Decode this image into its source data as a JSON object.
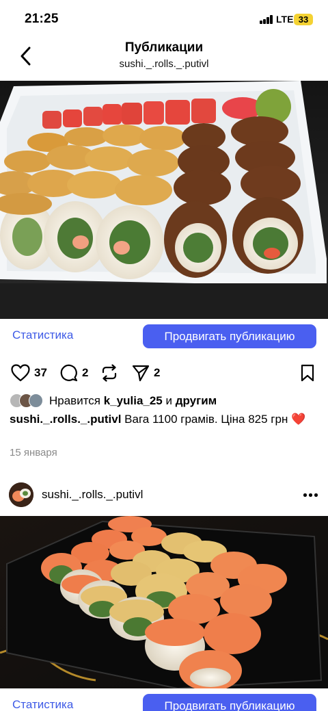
{
  "status_bar": {
    "time": "21:25",
    "network": "LTE",
    "battery": "33"
  },
  "header": {
    "title": "Публикации",
    "subtitle": "sushi._.rolls._.putivl"
  },
  "post1": {
    "stats_label": "Статистика",
    "promote_label": "Продвигать публикацию",
    "likes_count": "37",
    "comments_count": "2",
    "shares_count": "2",
    "liked_by_prefix": "Нравится",
    "liked_by_user": "k_yulia_25",
    "liked_by_and": "и",
    "liked_by_others": "другим",
    "caption_user": "sushi._.rolls._.putivl",
    "caption_text": "Вага 1100 грамів.  Ціна 825 грн",
    "caption_emoji": "❤️",
    "date": "15 января"
  },
  "post2": {
    "username": "sushi._.rolls._.putivl",
    "stats_label": "Статистика",
    "promote_label": "Продвигать публикацию"
  },
  "icons": [
    "chevron-left-icon",
    "heart-icon",
    "comment-icon",
    "repost-icon",
    "send-icon",
    "bookmark-icon",
    "more-icon"
  ],
  "colors": {
    "accent": "#4a5ff0",
    "link": "#3d5ae6",
    "battery": "#f4d233",
    "heart": "#e0313d",
    "date": "#8a8a8a"
  }
}
